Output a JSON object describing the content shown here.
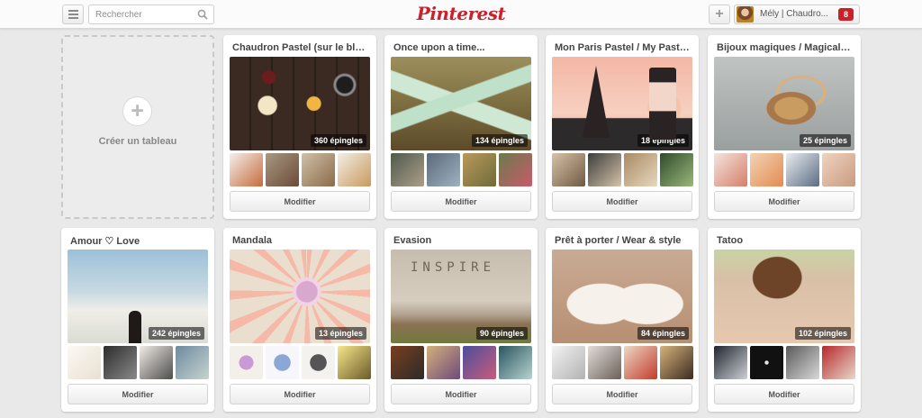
{
  "header": {
    "search_placeholder": "Rechercher",
    "logo": "Pinterest",
    "user_name": "Mély | Chaudro...",
    "notification_count": "8"
  },
  "create_board": {
    "label": "Créer un tableau"
  },
  "edit_label": "Modifier",
  "boards": [
    {
      "title": "Chaudron Pastel (sur le blog)",
      "pins": "360 épingles"
    },
    {
      "title": "Once upon a time...",
      "pins": "134 épingles"
    },
    {
      "title": "Mon Paris Pastel / My Pastel ...",
      "pins": "18 épingles"
    },
    {
      "title": "Bijoux magiques / Magical je...",
      "pins": "25 épingles"
    },
    {
      "title": "Amour ♡ Love",
      "pins": "242 épingles"
    },
    {
      "title": "Mandala",
      "pins": "13 épingles"
    },
    {
      "title": "Evasion",
      "pins": "90 épingles"
    },
    {
      "title": "Prêt à porter / Wear & style",
      "pins": "84 épingles"
    },
    {
      "title": "Tatoo",
      "pins": "102 épingles"
    }
  ]
}
